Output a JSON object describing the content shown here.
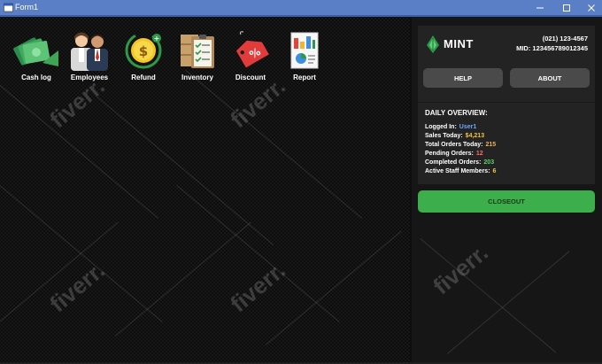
{
  "window": {
    "title": "Form1"
  },
  "nav": [
    {
      "label": "Cash log",
      "icon": "cash-icon"
    },
    {
      "label": "Employees",
      "icon": "employees-icon"
    },
    {
      "label": "Refund",
      "icon": "refund-coin-icon"
    },
    {
      "label": "Inventory",
      "icon": "inventory-clipboard-icon"
    },
    {
      "label": "Discount",
      "icon": "discount-tag-icon"
    },
    {
      "label": "Report",
      "icon": "report-chart-icon"
    }
  ],
  "sidebar": {
    "brand": "MINT",
    "phone": "(021) 123-4567",
    "mid": "MID: 123456789012345",
    "help_label": "HELP",
    "about_label": "ABOUT",
    "overview": {
      "title": "DAILY OVERVIEW:",
      "rows": [
        {
          "label": "Logged In:",
          "value": "User1"
        },
        {
          "label": "Sales Today:",
          "value": "$4,213"
        },
        {
          "label": "Total Orders Today:",
          "value": "215"
        },
        {
          "label": "Pending Orders:",
          "value": "12"
        },
        {
          "label": "Completed Orders:",
          "value": "203"
        },
        {
          "label": "Active Staff Members:",
          "value": "6"
        }
      ]
    },
    "closeout_label": "CLOSEOUT"
  },
  "watermark": "fiverr.",
  "colors": {
    "titlebar": "#5b7fc7",
    "accent_green": "#3cae4c",
    "user_blue": "#6aa8ff",
    "sales_gold": "#f0c24a",
    "orders_orange": "#f0b060",
    "pending_red": "#ff6b6b",
    "completed_green": "#5dd36a",
    "staff_yellow": "#f0c24a"
  }
}
